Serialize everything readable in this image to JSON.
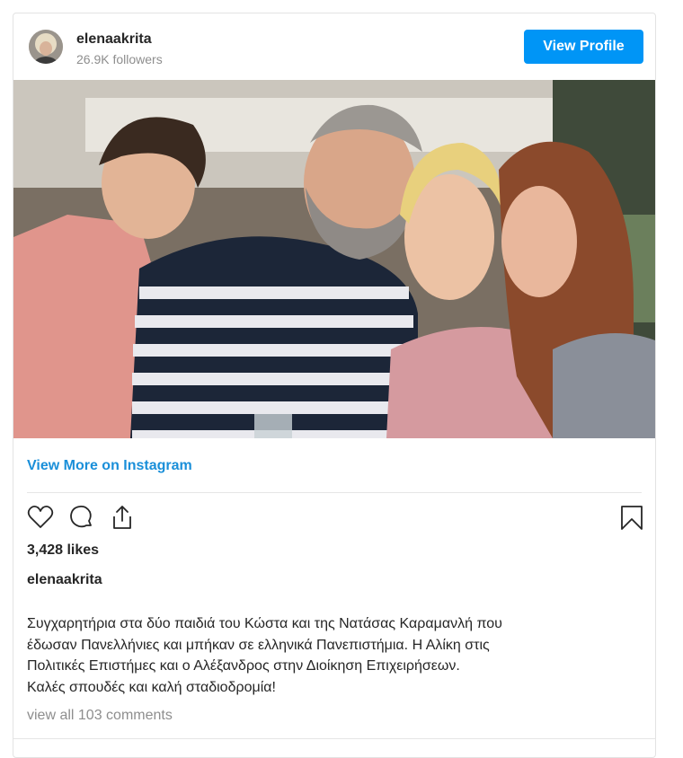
{
  "header": {
    "username": "elenaakrita",
    "followers": "26.9K followers",
    "view_profile_label": "View Profile"
  },
  "post": {
    "view_more_label": "View More on Instagram",
    "likes": "3,428 likes",
    "caption_user": "elenaakrita",
    "caption_lines": [
      "Συγχαρητήρια στα δύο παιδιά του Κώστα και της Νατάσας Καραμανλή που",
      "έδωσαν Πανελλήνιες και μπήκαν σε ελληνικά Πανεπιστήμια. Η Αλίκη στις",
      "Πολιτικές Επιστήμες και ο Αλέξανδρος στην Διοίκηση Επιχειρήσεων.",
      "Καλές σπουδές και καλή σταδιοδρομία!"
    ],
    "comments_label": "view all 103 comments"
  },
  "icons": {
    "like": "heart-icon",
    "comment": "comment-icon",
    "share": "share-icon",
    "save": "bookmark-icon"
  },
  "colors": {
    "accent": "#0095f6",
    "link": "#1a8fd9",
    "muted": "#8e8e8e"
  }
}
